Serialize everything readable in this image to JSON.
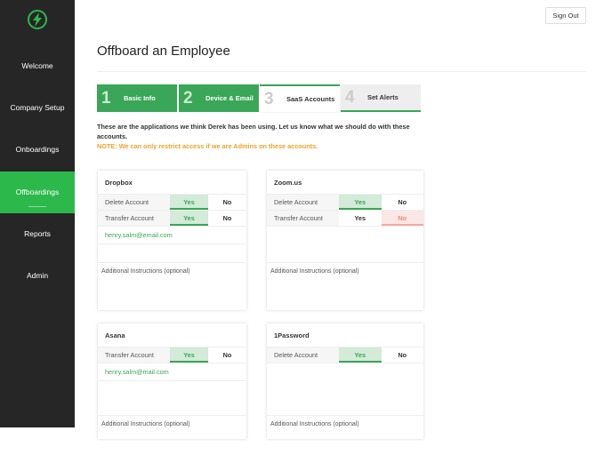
{
  "sidebar": {
    "items": [
      {
        "label": "Welcome"
      },
      {
        "label": "Company Setup"
      },
      {
        "label": "Onboardings"
      },
      {
        "label": "Offboardings"
      },
      {
        "label": "Reports"
      },
      {
        "label": "Admin"
      }
    ],
    "active": "Offboardings"
  },
  "header": {
    "sign_out": "Sign Out"
  },
  "page": {
    "title": "Offboard an Employee"
  },
  "steps": [
    {
      "num": "1",
      "label": "Basic Info"
    },
    {
      "num": "2",
      "label": "Device & Email"
    },
    {
      "num": "3",
      "label": "SaaS Accounts"
    },
    {
      "num": "4",
      "label": "Set Alerts"
    }
  ],
  "intro": "These are the applications we think Derek has been using. Let us know what we should do with these accounts.",
  "note": "NOTE: We can only restrict access if we are Admins on these accounts.",
  "options": {
    "yes": "Yes",
    "no": "No"
  },
  "instructions_placeholder": "Additional Instructions (optional)",
  "cards": [
    {
      "name": "Dropbox",
      "rows": [
        {
          "label": "Delete Account",
          "value": "Yes"
        },
        {
          "label": "Transfer Account",
          "value": "Yes"
        }
      ],
      "email": "henry.salm@email.com"
    },
    {
      "name": "Zoom.us",
      "rows": [
        {
          "label": "Delete Account",
          "value": "Yes"
        },
        {
          "label": "Transfer Account",
          "value": "No"
        }
      ]
    },
    {
      "name": "Asana",
      "rows": [
        {
          "label": "Transfer Account",
          "value": "Yes"
        }
      ],
      "email": "henry.salm@mail.com"
    },
    {
      "name": "1Password",
      "rows": [
        {
          "label": "Delete Account",
          "value": "Yes"
        }
      ]
    }
  ],
  "colors": {
    "accent": "#3aa657",
    "sidebar": "#262626",
    "active": "#2db84c",
    "note": "#f4a128"
  }
}
